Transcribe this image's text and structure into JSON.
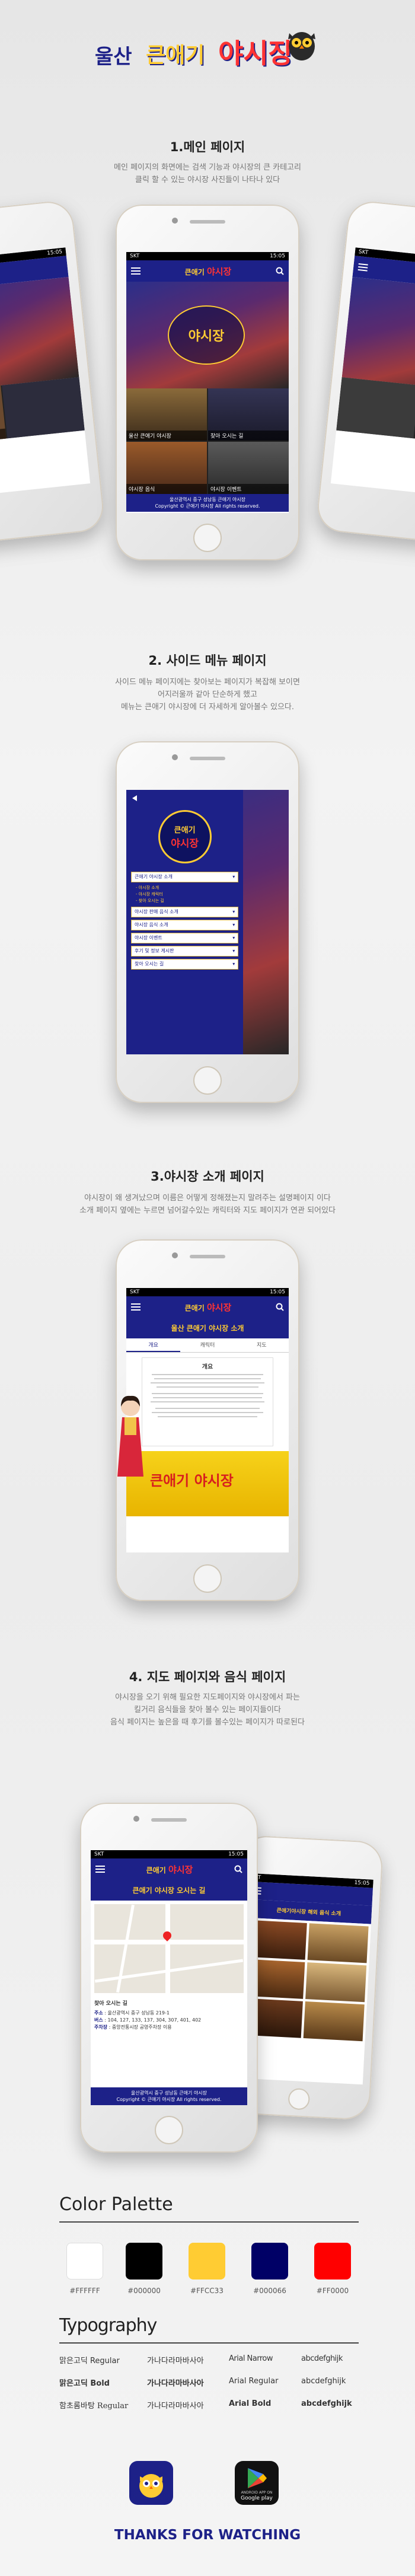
{
  "brand": {
    "logo_left": "울산",
    "logo_mid": "큰애기",
    "logo_right": "야시장",
    "colors": {
      "navy": "#1d2188",
      "yellow": "#FFCC33",
      "red": "#FF0000"
    }
  },
  "sections": [
    {
      "title": "1.메인 페이지",
      "desc": [
        "메인 페이지의 화면에는 검색 기능과 야시장의 큰 카테고리",
        "클릭 할 수 있는 야시장 사진들이 나타나 있다"
      ]
    },
    {
      "title": "2. 사이드 메뉴 페이지",
      "desc": [
        "사이드 메뉴 페이지에는 찾아보는 페이지가 복잡해 보이면",
        "어지러울까 같아 단순하게 했고",
        "메뉴는 큰애기 야시장에 더 자세하게 알아볼수 있으다."
      ]
    },
    {
      "title": "3.야시장 소개 페이지",
      "desc": [
        "야시장이 왜 생겨났으며 이름은 어떻게 정해졌는지 말려주는 설명페이지 이다",
        "소개 페이지 옆에는 누르면 넘어갈수있는 캐릭터와 지도 페이지가 연관 되어있다"
      ]
    },
    {
      "title": "4. 지도 페이지와 음식 페이지",
      "desc": [
        "야시장을 오기 위해 필요한 지도페이지와 야시장에서 파는",
        "킬거리 음식들을 찾아 볼수 있는 페이지들이다",
        "음식 페이지는 높은을 때 후기를 볼수있는 페이지가 따로된다"
      ]
    }
  ],
  "phone_ui": {
    "carrier": "SKT",
    "time": "15:05",
    "footer_line1": "울산광역시 중구 성남동 큰애기 야시장",
    "footer_line2": "Copyright © 큰애기 야시장 All rights reserved.",
    "cells": [
      "울산 큰애기 야시장",
      "찾아 오시는 길",
      "야시장 음식",
      "야시장 이벤트"
    ]
  },
  "side_menu": {
    "items": [
      "큰애기 야시장 소개",
      "야시장 판매 음식 소개",
      "야시장 음식 소개",
      "야시장 이벤트",
      "후기 및 정보 게시판",
      "찾아 오시는 길"
    ],
    "subs": [
      "- 야시장 소개",
      "- 야시장 캐릭터",
      "- 찾아 오시는 길"
    ]
  },
  "intro_page": {
    "header": "울산 큰애기 야시장 소개",
    "tabs": [
      "개요",
      "캐릭터",
      "지도"
    ],
    "heading": "개요",
    "sign_text": "큰애기 야시장"
  },
  "map_page": {
    "header": "큰애기 야시장 오시는 길",
    "info_title": "찾아 오시는 길",
    "address_label": "주소",
    "address": "울산광역시 중구 성남동 219-1",
    "bus_label": "버스",
    "bus": "104, 127, 133, 137, 304, 307, 401, 402",
    "parking_label": "주차장",
    "parking": "중앙전통시장 공영주차장 이용"
  },
  "food_page": {
    "header": "큰애기야시장 해외 음식 소개"
  },
  "palette": {
    "title": "Color Palette",
    "swatches": [
      {
        "hex": "#FFFFFF",
        "label": "#FFFFFF"
      },
      {
        "hex": "#000000",
        "label": "#000000"
      },
      {
        "hex": "#FFCC33",
        "label": "#FFCC33"
      },
      {
        "hex": "#000066",
        "label": "#000066"
      },
      {
        "hex": "#FF0000",
        "label": "#FF0000"
      }
    ]
  },
  "typography": {
    "title": "Typography",
    "rows": [
      {
        "font": "맑은고딕 Regular",
        "ko_sample": "가나다라마바사아",
        "en_font": "Arial Narrow",
        "en_sample": "abcdefghijk"
      },
      {
        "font": "맑은고딕 Bold",
        "ko_sample": "가나다라마바사아",
        "en_font": "Arial Regular",
        "en_sample": "abcdefghijk"
      },
      {
        "font": "함초롬바탕 Regular",
        "ko_sample": "가나다라마바사아",
        "en_font": "Arial Bold",
        "en_sample": "abcdefghijk"
      }
    ]
  },
  "store": {
    "google_top": "ANDROID APP ON",
    "google_bottom": "Google play"
  },
  "thanks": "THANKS FOR WATCHING"
}
